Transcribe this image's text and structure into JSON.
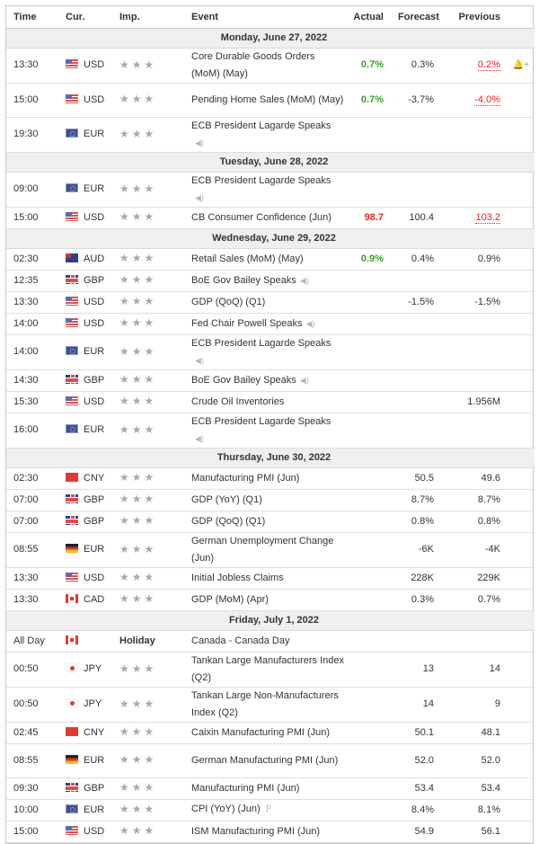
{
  "columns": {
    "time": "Time",
    "currency": "Cur.",
    "importance": "Imp.",
    "event": "Event",
    "actual": "Actual",
    "forecast": "Forecast",
    "previous": "Previous"
  },
  "days": [
    {
      "label": "Monday, June 27, 2022",
      "events": [
        {
          "time": "13:30",
          "flag": "usd",
          "currency": "USD",
          "stars": "★★★",
          "event": "Core Durable Goods Orders (MoM) (May)",
          "actual": "0.7%",
          "actual_style": "green",
          "forecast": "0.3%",
          "previous": "0.2%",
          "previous_style": "revised",
          "tall": true,
          "bell": "🔔+"
        },
        {
          "time": "15:00",
          "flag": "usd",
          "currency": "USD",
          "stars": "★★★",
          "event": "Pending Home Sales (MoM) (May)",
          "actual": "0.7%",
          "actual_style": "green",
          "forecast": "-3.7%",
          "previous": "-4.0%",
          "previous_style": "revised",
          "tall": true
        },
        {
          "time": "19:30",
          "flag": "eur",
          "currency": "EUR",
          "stars": "★★★",
          "event": "ECB President Lagarde Speaks",
          "speaker": true,
          "speaker_newline": true,
          "actual": "",
          "forecast": "",
          "previous": "",
          "tall": true
        }
      ]
    },
    {
      "label": "Tuesday, June 28, 2022",
      "events": [
        {
          "time": "09:00",
          "flag": "eur",
          "currency": "EUR",
          "stars": "★★★",
          "event": "ECB President Lagarde Speaks",
          "speaker": true,
          "speaker_newline": true,
          "actual": "",
          "forecast": "",
          "previous": "",
          "tall": true
        },
        {
          "time": "15:00",
          "flag": "usd",
          "currency": "USD",
          "stars": "★★★",
          "event": "CB Consumer Confidence (Jun)",
          "actual": "98.7",
          "actual_style": "redb",
          "forecast": "100.4",
          "previous": "103.2",
          "previous_style": "revised"
        }
      ]
    },
    {
      "label": "Wednesday, June 29, 2022",
      "events": [
        {
          "time": "02:30",
          "flag": "aud",
          "currency": "AUD",
          "stars": "★★★",
          "event": "Retail Sales (MoM) (May)",
          "actual": "0.9%",
          "actual_style": "green",
          "forecast": "0.4%",
          "previous": "0.9%"
        },
        {
          "time": "12:35",
          "flag": "gbp",
          "currency": "GBP",
          "stars": "★★★",
          "event": "BoE Gov Bailey Speaks",
          "speaker": true,
          "actual": "",
          "forecast": "",
          "previous": ""
        },
        {
          "time": "13:30",
          "flag": "usd",
          "currency": "USD",
          "stars": "★★★",
          "event": "GDP (QoQ) (Q1)",
          "actual": "",
          "forecast": "-1.5%",
          "previous": "-1.5%"
        },
        {
          "time": "14:00",
          "flag": "usd",
          "currency": "USD",
          "stars": "★★★",
          "event": "Fed Chair Powell Speaks",
          "speaker": true,
          "actual": "",
          "forecast": "",
          "previous": ""
        },
        {
          "time": "14:00",
          "flag": "eur",
          "currency": "EUR",
          "stars": "★★★",
          "event": "ECB President Lagarde Speaks",
          "speaker": true,
          "speaker_newline": true,
          "actual": "",
          "forecast": "",
          "previous": "",
          "tall": true
        },
        {
          "time": "14:30",
          "flag": "gbp",
          "currency": "GBP",
          "stars": "★★★",
          "event": "BoE Gov Bailey Speaks",
          "speaker": true,
          "actual": "",
          "forecast": "",
          "previous": ""
        },
        {
          "time": "15:30",
          "flag": "usd",
          "currency": "USD",
          "stars": "★★★",
          "event": "Crude Oil Inventories",
          "actual": "",
          "forecast": "",
          "previous": "1.956M"
        },
        {
          "time": "16:00",
          "flag": "eur",
          "currency": "EUR",
          "stars": "★★★",
          "event": "ECB President Lagarde Speaks",
          "speaker": true,
          "speaker_newline": true,
          "actual": "",
          "forecast": "",
          "previous": "",
          "tall": true
        }
      ]
    },
    {
      "label": "Thursday, June 30, 2022",
      "events": [
        {
          "time": "02:30",
          "flag": "cny",
          "currency": "CNY",
          "stars": "★★★",
          "event": "Manufacturing PMI (Jun)",
          "actual": "",
          "forecast": "50.5",
          "previous": "49.6"
        },
        {
          "time": "07:00",
          "flag": "gbp",
          "currency": "GBP",
          "stars": "★★★",
          "event": "GDP (YoY) (Q1)",
          "actual": "",
          "forecast": "8.7%",
          "previous": "8.7%"
        },
        {
          "time": "07:00",
          "flag": "gbp",
          "currency": "GBP",
          "stars": "★★★",
          "event": "GDP (QoQ) (Q1)",
          "actual": "",
          "forecast": "0.8%",
          "previous": "0.8%"
        },
        {
          "time": "08:55",
          "flag": "eurde",
          "currency": "EUR",
          "stars": "★★★",
          "event": "German Unemployment Change (Jun)",
          "actual": "",
          "forecast": "-6K",
          "previous": "-4K",
          "tall": true
        },
        {
          "time": "13:30",
          "flag": "usd",
          "currency": "USD",
          "stars": "★★★",
          "event": "Initial Jobless Claims",
          "actual": "",
          "forecast": "228K",
          "previous": "229K"
        },
        {
          "time": "13:30",
          "flag": "cad",
          "currency": "CAD",
          "stars": "★★★",
          "event": "GDP (MoM) (Apr)",
          "actual": "",
          "forecast": "0.3%",
          "previous": "0.7%"
        }
      ]
    },
    {
      "label": "Friday, July 1, 2022",
      "events": [
        {
          "time": "All Day",
          "flag": "cad",
          "currency": "",
          "holiday": "Holiday",
          "event": "Canada - Canada Day",
          "actual": "",
          "forecast": "",
          "previous": ""
        },
        {
          "time": "00:50",
          "flag": "jpy",
          "currency": "JPY",
          "stars": "★★★",
          "event": "Tankan Large Manufacturers Index (Q2)",
          "actual": "",
          "forecast": "13",
          "previous": "14",
          "tall": true
        },
        {
          "time": "00:50",
          "flag": "jpy",
          "currency": "JPY",
          "stars": "★★★",
          "event": "Tankan Large Non-Manufacturers Index (Q2)",
          "actual": "",
          "forecast": "14",
          "previous": "9",
          "tall": true
        },
        {
          "time": "02:45",
          "flag": "cny",
          "currency": "CNY",
          "stars": "★★★",
          "event": "Caixin Manufacturing PMI (Jun)",
          "actual": "",
          "forecast": "50.1",
          "previous": "48.1"
        },
        {
          "time": "08:55",
          "flag": "eurde",
          "currency": "EUR",
          "stars": "★★★",
          "event": "German Manufacturing PMI (Jun)",
          "actual": "",
          "forecast": "52.0",
          "previous": "52.0",
          "tall": true
        },
        {
          "time": "09:30",
          "flag": "gbp",
          "currency": "GBP",
          "stars": "★★★",
          "event": "Manufacturing PMI (Jun)",
          "actual": "",
          "forecast": "53.4",
          "previous": "53.4"
        },
        {
          "time": "10:00",
          "flag": "eur",
          "currency": "EUR",
          "stars": "★★★",
          "event": "CPI (YoY) (Jun)",
          "preliminary": "P",
          "actual": "",
          "forecast": "8.4%",
          "previous": "8.1%"
        },
        {
          "time": "15:00",
          "flag": "usd",
          "currency": "USD",
          "stars": "★★★",
          "event": "ISM Manufacturing PMI (Jun)",
          "actual": "",
          "forecast": "54.9",
          "previous": "56.1"
        }
      ]
    }
  ],
  "icons": {
    "speaker": "🔈",
    "speaker_glyph": "◀)",
    "bell": "🔔+"
  },
  "colors": {
    "positive": "#3aa12e",
    "negative": "#ee2222",
    "day_header_bg": "#efefef",
    "star": "#a9a9a9"
  }
}
